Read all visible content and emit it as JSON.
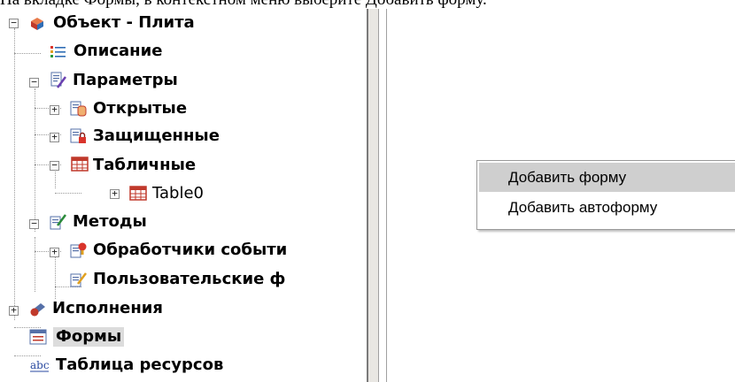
{
  "caption": "На вкладке Формы, в контекстном меню выберите Добавить форму.",
  "tree": {
    "root": "Объект - Плита",
    "description": "Описание",
    "parameters": "Параметры",
    "open": "Открытые",
    "protected": "Защищенные",
    "table": "Табличные",
    "table0": "Table0",
    "methods": "Методы",
    "event_handlers": "Обработчики событи",
    "user_functions": "Пользовательские ф",
    "executions": "Исполнения",
    "forms": "Формы",
    "resources": "Таблица ресурсов"
  },
  "context_menu": {
    "items": [
      "Добавить форму",
      "Добавить автоформу"
    ]
  }
}
